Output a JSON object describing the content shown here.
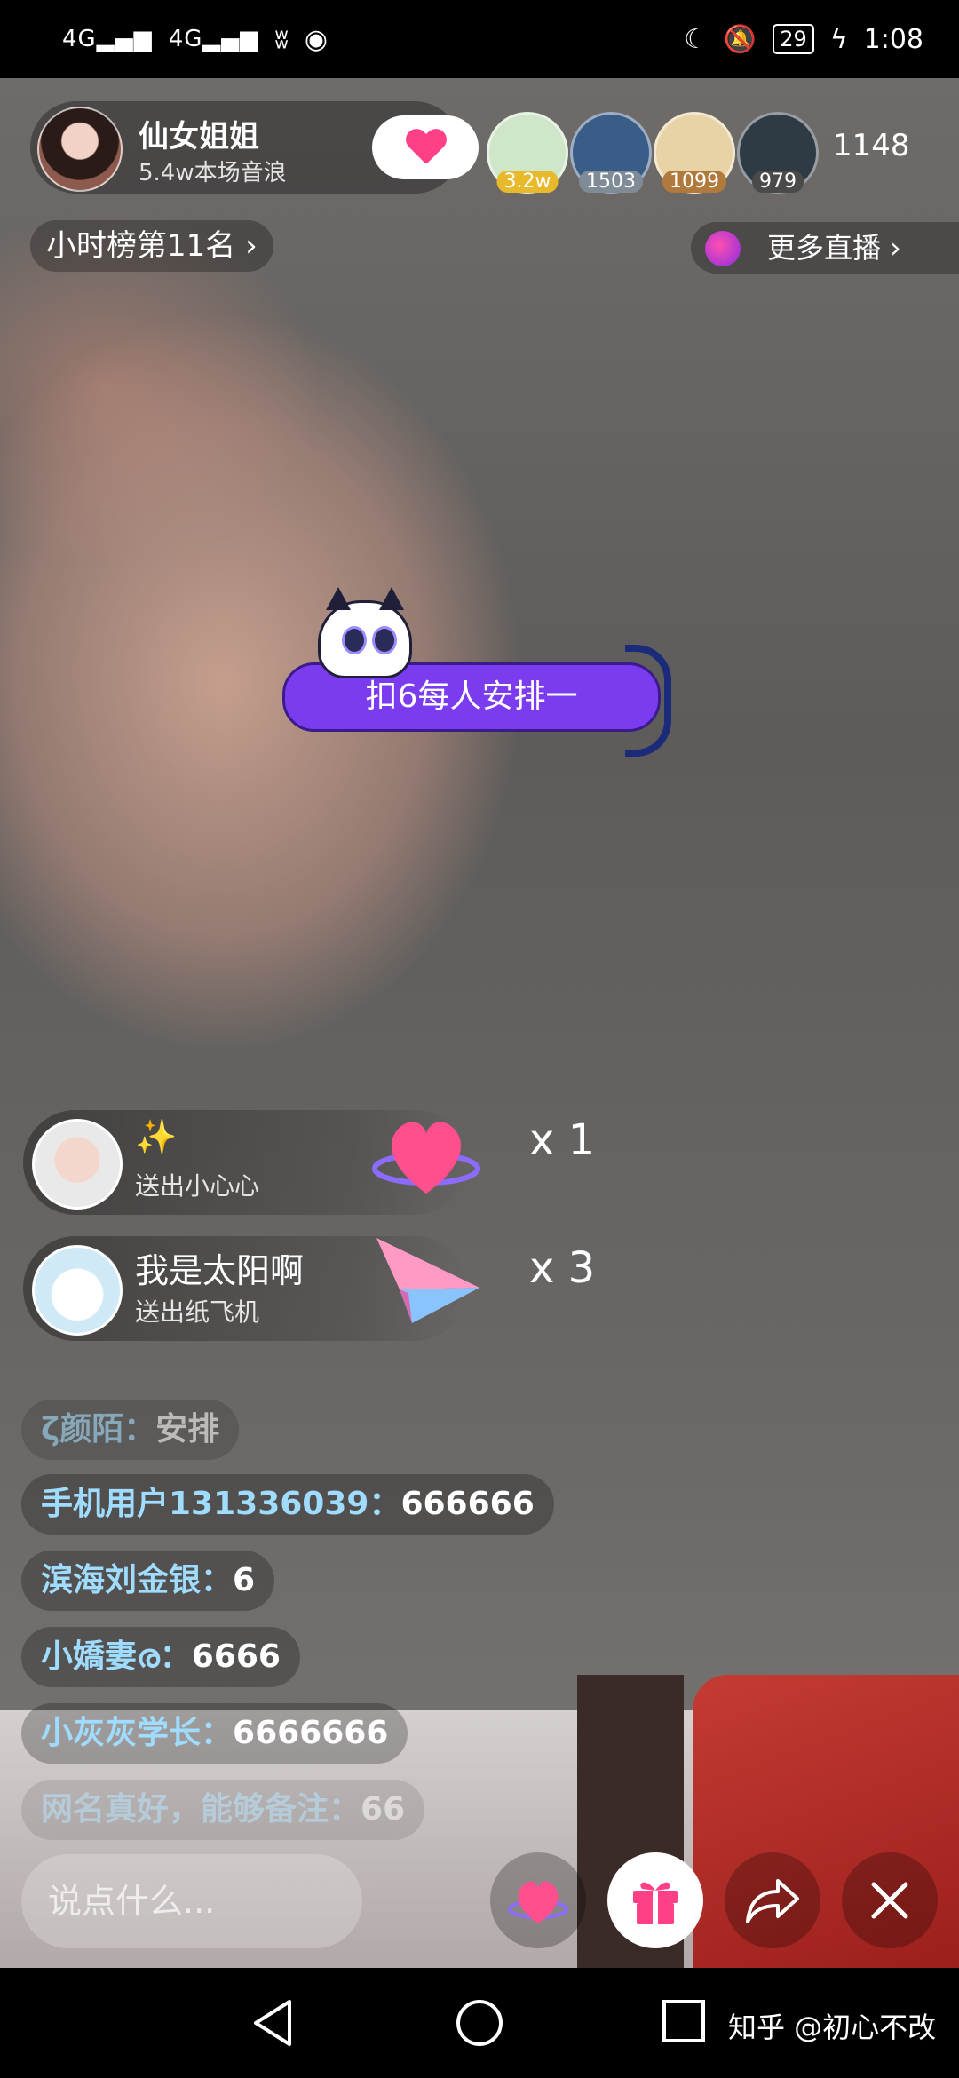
{
  "status_bar": {
    "sig1": "4G",
    "sig2": "4G",
    "battery": "29",
    "time": "1:08"
  },
  "host": {
    "name": "仙女姐姐",
    "subtitle": "5.4w本场音浪"
  },
  "viewers": [
    {
      "badge": "3.2w",
      "badge_color": "#e7b92b",
      "avatar_color": "#cfe6c9"
    },
    {
      "badge": "1503",
      "badge_color": "#7f8c98",
      "avatar_color": "#3a5d88"
    },
    {
      "badge": "1099",
      "badge_color": "#b17a3d",
      "avatar_color": "#e7d3a6"
    },
    {
      "badge": "979",
      "badge_color": "#4a4a4a",
      "avatar_color": "#2e3a44"
    }
  ],
  "online_count": "1148",
  "hour_rank": "小时榜第11名 ›",
  "more_live": "更多直播 ›",
  "cat_banner": "扣6每人安排一",
  "gifts": [
    {
      "user": "✨",
      "action": "送出小心心",
      "count": "x 1",
      "gift_icon": "heart-gift-icon"
    },
    {
      "user": "我是太阳啊",
      "action": "送出纸飞机",
      "count": "x 3",
      "gift_icon": "paper-plane-icon"
    }
  ],
  "comments": [
    {
      "user": "ζ颜陌：",
      "msg": "安排"
    },
    {
      "user": "手机用户131336039：",
      "msg": "666666"
    },
    {
      "user": "滨海刘金银：",
      "msg": "6"
    },
    {
      "user": "小嬌妻ര：",
      "msg": "6666"
    },
    {
      "user": "小灰灰学长：",
      "msg": "6666666"
    },
    {
      "user": "网名真好，能够备注：",
      "msg": "66"
    }
  ],
  "input_placeholder": "说点什么...",
  "watermark": "知乎 @初心不改",
  "colors": {
    "accent_pink": "#ff3f86",
    "comment_user": "#9fdcff",
    "banner_purple": "#7b3cf0"
  }
}
